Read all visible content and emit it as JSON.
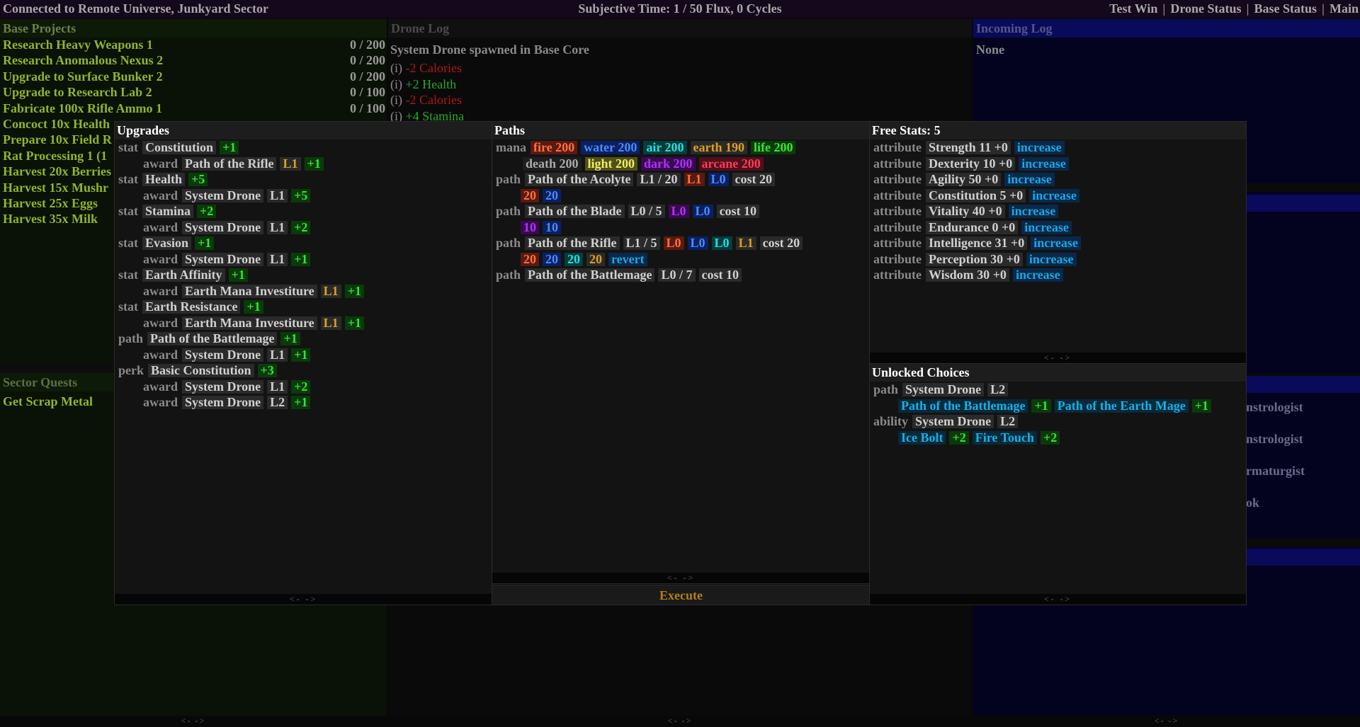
{
  "topbar": {
    "connection": "Connected to Remote Universe, Junkyard Sector",
    "time": "Subjective Time: 1 / 50 Flux,  0 Cycles",
    "nav": [
      "Test Win",
      "Drone Status",
      "Base Status",
      "Main"
    ]
  },
  "base_projects": {
    "title": "Base Projects",
    "items": [
      {
        "label": "Research Heavy Weapons 1",
        "progress": "0 / 200"
      },
      {
        "label": "Research Anomalous Nexus 2",
        "progress": "0 / 200"
      },
      {
        "label": "Upgrade to Surface Bunker 2",
        "progress": "0 / 200"
      },
      {
        "label": "Upgrade to Research Lab 2",
        "progress": "0 / 100"
      },
      {
        "label": "Fabricate 100x Rifle Ammo 1",
        "progress": "0 / 100"
      },
      {
        "label": "Concoct 10x Health",
        "progress": ""
      },
      {
        "label": "Prepare 10x Field R",
        "progress": ""
      },
      {
        "label": "Rat Processing 1 (1",
        "progress": ""
      },
      {
        "label": "Harvest 20x Berries",
        "progress": ""
      },
      {
        "label": "Harvest 15x Mushr",
        "progress": ""
      },
      {
        "label": "Harvest 25x Eggs",
        "progress": ""
      },
      {
        "label": "Harvest 35x Milk",
        "progress": ""
      }
    ],
    "pager": "<-   ->"
  },
  "sector_quests": {
    "title": "Sector Quests",
    "items": [
      "Get Scrap Metal"
    ]
  },
  "drone_log": {
    "title": "Drone Log",
    "first": "System Drone spawned in Base Core",
    "entries": [
      {
        "prefix": "(i)",
        "text": "-2 Calories",
        "kind": "neg"
      },
      {
        "prefix": "(i)",
        "text": "+2 Health",
        "kind": "pos"
      },
      {
        "prefix": "(i)",
        "text": "-2 Calories",
        "kind": "neg"
      },
      {
        "prefix": "(i)",
        "text": "+4 Stamina",
        "kind": "pos"
      }
    ],
    "pager": "<-   ->"
  },
  "incoming_log": {
    "title": "Incoming Log",
    "none": "None",
    "partial_items": [
      "nstrologist",
      "nstrologist",
      "rmaturgist",
      "ok"
    ],
    "pager": "<-   ->"
  },
  "upgrades": {
    "title": "Upgrades",
    "rows": [
      {
        "kw": "stat",
        "ind": 0,
        "tags": [
          {
            "t": "Constitution",
            "c": ""
          },
          {
            "t": "+1",
            "c": "g"
          }
        ]
      },
      {
        "kw": "award",
        "ind": 1,
        "tags": [
          {
            "t": "Path of the Rifle",
            "c": ""
          },
          {
            "t": "L1",
            "c": "o"
          },
          {
            "t": "+1",
            "c": "g"
          }
        ]
      },
      {
        "kw": "stat",
        "ind": 0,
        "tags": [
          {
            "t": "Health",
            "c": ""
          },
          {
            "t": "+5",
            "c": "g"
          }
        ]
      },
      {
        "kw": "award",
        "ind": 1,
        "tags": [
          {
            "t": "System Drone",
            "c": ""
          },
          {
            "t": "L1",
            "c": ""
          },
          {
            "t": "+5",
            "c": "g"
          }
        ]
      },
      {
        "kw": "stat",
        "ind": 0,
        "tags": [
          {
            "t": "Stamina",
            "c": ""
          },
          {
            "t": "+2",
            "c": "g"
          }
        ]
      },
      {
        "kw": "award",
        "ind": 1,
        "tags": [
          {
            "t": "System Drone",
            "c": ""
          },
          {
            "t": "L1",
            "c": ""
          },
          {
            "t": "+2",
            "c": "g"
          }
        ]
      },
      {
        "kw": "stat",
        "ind": 0,
        "tags": [
          {
            "t": "Evasion",
            "c": ""
          },
          {
            "t": "+1",
            "c": "g"
          }
        ]
      },
      {
        "kw": "award",
        "ind": 1,
        "tags": [
          {
            "t": "System Drone",
            "c": ""
          },
          {
            "t": "L1",
            "c": ""
          },
          {
            "t": "+1",
            "c": "g"
          }
        ]
      },
      {
        "kw": "stat",
        "ind": 0,
        "tags": [
          {
            "t": "Earth Affinity",
            "c": ""
          },
          {
            "t": "+1",
            "c": "g"
          }
        ]
      },
      {
        "kw": "award",
        "ind": 1,
        "tags": [
          {
            "t": "Earth Mana Investiture",
            "c": ""
          },
          {
            "t": "L1",
            "c": "o"
          },
          {
            "t": "+1",
            "c": "g"
          }
        ]
      },
      {
        "kw": "stat",
        "ind": 0,
        "tags": [
          {
            "t": "Earth Resistance",
            "c": ""
          },
          {
            "t": "+1",
            "c": "g"
          }
        ]
      },
      {
        "kw": "award",
        "ind": 1,
        "tags": [
          {
            "t": "Earth Mana Investiture",
            "c": ""
          },
          {
            "t": "L1",
            "c": "o"
          },
          {
            "t": "+1",
            "c": "g"
          }
        ]
      },
      {
        "kw": "path",
        "ind": 0,
        "tags": [
          {
            "t": "Path of the Battlemage",
            "c": ""
          },
          {
            "t": "+1",
            "c": "g"
          }
        ]
      },
      {
        "kw": "award",
        "ind": 1,
        "tags": [
          {
            "t": "System Drone",
            "c": ""
          },
          {
            "t": "L1",
            "c": ""
          },
          {
            "t": "+1",
            "c": "g"
          }
        ]
      },
      {
        "kw": "perk",
        "ind": 0,
        "tags": [
          {
            "t": "Basic Constitution",
            "c": ""
          },
          {
            "t": "+3",
            "c": "g"
          }
        ]
      },
      {
        "kw": "award",
        "ind": 1,
        "tags": [
          {
            "t": "System Drone",
            "c": ""
          },
          {
            "t": "L1",
            "c": ""
          },
          {
            "t": "+2",
            "c": "g"
          }
        ]
      },
      {
        "kw": "award",
        "ind": 1,
        "tags": [
          {
            "t": "System Drone",
            "c": ""
          },
          {
            "t": "L2",
            "c": ""
          },
          {
            "t": "+1",
            "c": "g"
          }
        ]
      }
    ],
    "pager": "<-   ->"
  },
  "paths": {
    "title": "Paths",
    "rows": [
      {
        "kw": "mana",
        "ind": 0,
        "tags": [
          {
            "t": "fire 200",
            "c": "r"
          },
          {
            "t": "water 200",
            "c": "lb"
          },
          {
            "t": "air 200",
            "c": "c"
          },
          {
            "t": "earth 190",
            "c": "o"
          },
          {
            "t": "life 200",
            "c": "g"
          }
        ]
      },
      {
        "kw": "",
        "ind": 2,
        "tags": [
          {
            "t": "death 200",
            "c": "gr"
          },
          {
            "t": "light 200",
            "c": "y"
          },
          {
            "t": "dark 200",
            "c": "p"
          },
          {
            "t": "arcane 200",
            "c": "rd"
          }
        ]
      },
      {
        "kw": "path",
        "ind": 0,
        "tags": [
          {
            "t": "Path of the Acolyte",
            "c": ""
          },
          {
            "t": "L1 / 20",
            "c": ""
          },
          {
            "t": "L1",
            "c": "r"
          },
          {
            "t": "L0",
            "c": "lb"
          },
          {
            "t": "cost 20",
            "c": ""
          }
        ]
      },
      {
        "kw": "",
        "ind": 3,
        "tags": [
          {
            "t": "20",
            "c": "r"
          },
          {
            "t": "20",
            "c": "lb"
          }
        ]
      },
      {
        "kw": "path",
        "ind": 0,
        "tags": [
          {
            "t": "Path of the Blade",
            "c": ""
          },
          {
            "t": "L0 / 5",
            "c": ""
          },
          {
            "t": "L0",
            "c": "p"
          },
          {
            "t": "L0",
            "c": "lb"
          },
          {
            "t": "cost 10",
            "c": ""
          }
        ]
      },
      {
        "kw": "",
        "ind": 3,
        "tags": [
          {
            "t": "10",
            "c": "p"
          },
          {
            "t": "10",
            "c": "lb"
          }
        ]
      },
      {
        "kw": "path",
        "ind": 0,
        "tags": [
          {
            "t": "Path of the Rifle",
            "c": ""
          },
          {
            "t": "L1 / 5",
            "c": ""
          },
          {
            "t": "L0",
            "c": "r"
          },
          {
            "t": "L0",
            "c": "lb"
          },
          {
            "t": "L0",
            "c": "c"
          },
          {
            "t": "L1",
            "c": "o"
          },
          {
            "t": "cost 20",
            "c": ""
          }
        ]
      },
      {
        "kw": "",
        "ind": 3,
        "tags": [
          {
            "t": "20",
            "c": "r"
          },
          {
            "t": "20",
            "c": "lb"
          },
          {
            "t": "20",
            "c": "c"
          },
          {
            "t": "20",
            "c": "o"
          },
          {
            "t": "revert",
            "c": "inc"
          }
        ]
      },
      {
        "kw": "path",
        "ind": 0,
        "tags": [
          {
            "t": "Path of the Battlemage",
            "c": ""
          },
          {
            "t": "L0 / 7",
            "c": ""
          },
          {
            "t": "cost 10",
            "c": ""
          }
        ]
      }
    ],
    "pager": "<-   ->",
    "execute": "Execute"
  },
  "free_stats": {
    "title": "Free Stats: 5",
    "rows": [
      {
        "kw": "attribute",
        "label": "Strength 11 +0",
        "action": "increase"
      },
      {
        "kw": "attribute",
        "label": "Dexterity 10 +0",
        "action": "increase"
      },
      {
        "kw": "attribute",
        "label": "Agility 50 +0",
        "action": "increase"
      },
      {
        "kw": "attribute",
        "label": "Constitution 5 +0",
        "action": "increase"
      },
      {
        "kw": "attribute",
        "label": "Vitality 40 +0",
        "action": "increase"
      },
      {
        "kw": "attribute",
        "label": "Endurance 0 +0",
        "action": "increase"
      },
      {
        "kw": "attribute",
        "label": "Intelligence 31 +0",
        "action": "increase"
      },
      {
        "kw": "attribute",
        "label": "Perception 30 +0",
        "action": "increase"
      },
      {
        "kw": "attribute",
        "label": "Wisdom 30 +0",
        "action": "increase"
      }
    ],
    "pager": "<-   ->"
  },
  "unlocked_choices": {
    "title": "Unlocked Choices",
    "rows": [
      {
        "kw": "path",
        "ind": 0,
        "tags": [
          {
            "t": "System Drone",
            "c": ""
          },
          {
            "t": "L2",
            "c": ""
          }
        ]
      },
      {
        "kw": "",
        "ind": 3,
        "links": [
          {
            "t": "Path of the Battlemage",
            "v": "+1"
          },
          {
            "t": "Path of the Earth Mage",
            "v": "+1"
          }
        ]
      },
      {
        "kw": "ability",
        "ind": 0,
        "tags": [
          {
            "t": "System Drone",
            "c": ""
          },
          {
            "t": "L2",
            "c": ""
          }
        ]
      },
      {
        "kw": "",
        "ind": 3,
        "links": [
          {
            "t": "Ice Bolt",
            "v": "+2"
          },
          {
            "t": "Fire Touch",
            "v": "+2"
          }
        ]
      }
    ],
    "pager": "<-   ->"
  }
}
